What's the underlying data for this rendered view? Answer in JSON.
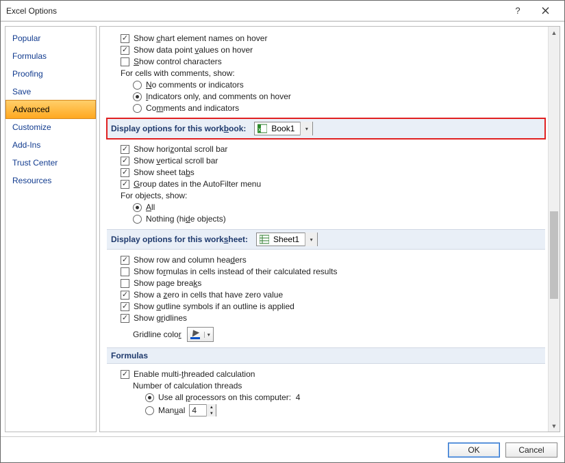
{
  "window": {
    "title": "Excel Options"
  },
  "sidebar": {
    "items": [
      {
        "label": "Popular"
      },
      {
        "label": "Formulas"
      },
      {
        "label": "Proofing"
      },
      {
        "label": "Save"
      },
      {
        "label": "Advanced",
        "selected": true
      },
      {
        "label": "Customize"
      },
      {
        "label": "Add-Ins"
      },
      {
        "label": "Trust Center"
      },
      {
        "label": "Resources"
      }
    ]
  },
  "top": {
    "chart_names": "Show chart element names on hover",
    "data_point": "Show data point values on hover",
    "control_chars": "Show control characters",
    "cells_comments_label": "For cells with comments, show:",
    "opt_no_comments": "No comments or indicators",
    "opt_indicators_only": "Indicators only, and comments on hover",
    "opt_comments_and": "Comments and indicators"
  },
  "sec_workbook": {
    "title": "Display options for this workbook:",
    "dropdown": "Book1",
    "hscroll": "Show horizontal scroll bar",
    "vscroll": "Show vertical scroll bar",
    "tabs": "Show sheet tabs",
    "group_dates": "Group dates in the AutoFilter menu",
    "objects_label": "For objects, show:",
    "obj_all": "All",
    "obj_nothing": "Nothing (hide objects)"
  },
  "sec_worksheet": {
    "title": "Display options for this worksheet:",
    "dropdown": "Sheet1",
    "row_col_headers": "Show row and column headers",
    "show_formulas": "Show formulas in cells instead of their calculated results",
    "page_breaks": "Show page breaks",
    "zero_values": "Show a zero in cells that have zero value",
    "outline_symbols": "Show outline symbols if an outline is applied",
    "gridlines": "Show gridlines",
    "gridline_color_label": "Gridline color"
  },
  "sec_formulas": {
    "title": "Formulas",
    "enable_mt": "Enable multi-threaded calculation",
    "num_threads_label": "Number of calculation threads",
    "use_all_label": "Use all processors on this computer:",
    "use_all_value": "4",
    "manual_label": "Manual",
    "manual_value": "4"
  },
  "footer": {
    "ok": "OK",
    "cancel": "Cancel"
  }
}
